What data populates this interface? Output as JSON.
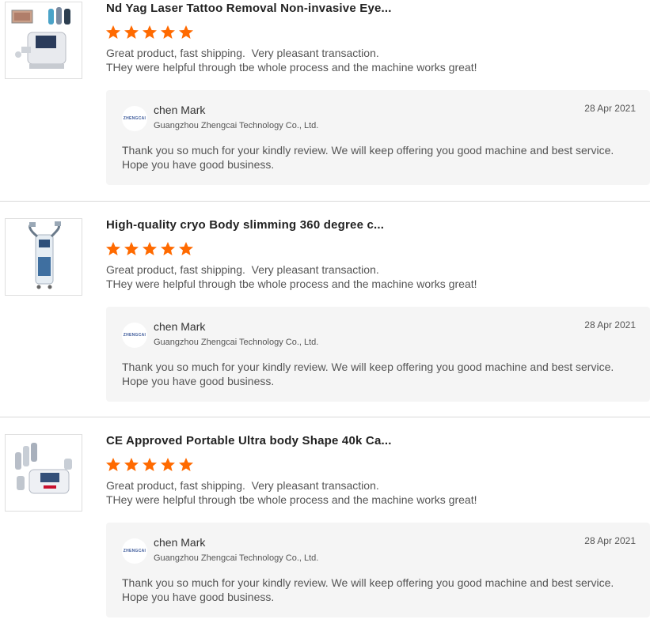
{
  "reviews": [
    {
      "title": "Nd Yag Laser Tattoo Removal Non-invasive Eye...",
      "comment": "Great product, fast shipping.  Very pleasant transaction.\nTHey were helpful through tbe whole process and the machine works great!",
      "rating": 5,
      "reply": {
        "avatar_text": "ZHENGCAI",
        "name": "chen Mark",
        "company": "Guangzhou Zhengcai Technology Co., Ltd.",
        "date": "28 Apr 2021",
        "text": "Thank you so much for your kindly review. We will keep offering you good machine and best service. Hope you have good business."
      }
    },
    {
      "title": "High-quality cryo Body slimming 360 degree c...",
      "comment": "Great product, fast shipping.  Very pleasant transaction.\nTHey were helpful through tbe whole process and the machine works great!",
      "rating": 5,
      "reply": {
        "avatar_text": "ZHENGCAI",
        "name": "chen Mark",
        "company": "Guangzhou Zhengcai Technology Co., Ltd.",
        "date": "28 Apr 2021",
        "text": "Thank you so much for your kindly review. We will keep offering you good machine and best service. Hope you have good business."
      }
    },
    {
      "title": "CE Approved Portable Ultra body Shape 40k Ca...",
      "comment": "Great product, fast shipping.  Very pleasant transaction.\nTHey were helpful through tbe whole process and the machine works great!",
      "rating": 5,
      "reply": {
        "avatar_text": "ZHENGCAI",
        "name": "chen Mark",
        "company": "Guangzhou Zhengcai Technology Co., Ltd.",
        "date": "28 Apr 2021",
        "text": "Thank you so much for your kindly review. We will keep offering you good machine and best service. Hope you have good business."
      }
    }
  ],
  "colors": {
    "star": "#ff6a00",
    "reply_bg": "#f5f5f5",
    "divider": "#d9d9d9"
  }
}
